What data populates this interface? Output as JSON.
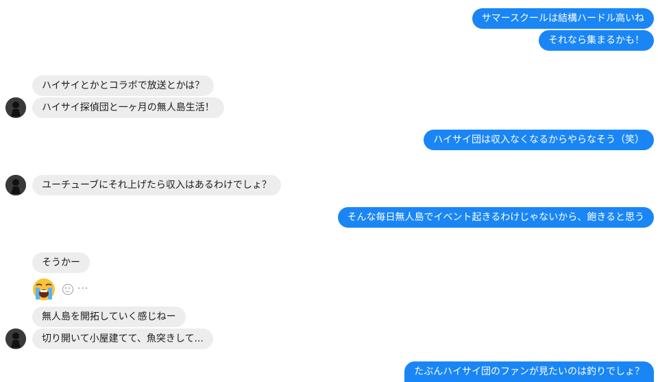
{
  "messages": {
    "m1": "サマースクールは結構ハードル高いね",
    "m2": "それなら集まるかも！",
    "m3": "ハイサイとかとコラボで放送とかは？",
    "m4": "ハイサイ探偵団と一ヶ月の無人島生活！",
    "m5": "ハイサイ団は収入なくなるからやらなそう（笑）",
    "m6": "ユーチューブにそれ上げたら収入はあるわけでしょ？",
    "m7": "そんな毎日無人島でイベント起きるわけじゃないから、飽きると思う",
    "m8": "そうかー",
    "m9": "無人島を開拓していく感じねー",
    "m10": "切り開いて小屋建てて、魚突きして...",
    "m11": "たぶんハイサイ団のファンが見たいのは釣りでしょ？"
  },
  "reaction": {
    "emoji_name": "loudly-crying-face-icon",
    "more": "···"
  },
  "colors": {
    "outgoing": "#1a86f5",
    "incoming": "#ededed"
  }
}
